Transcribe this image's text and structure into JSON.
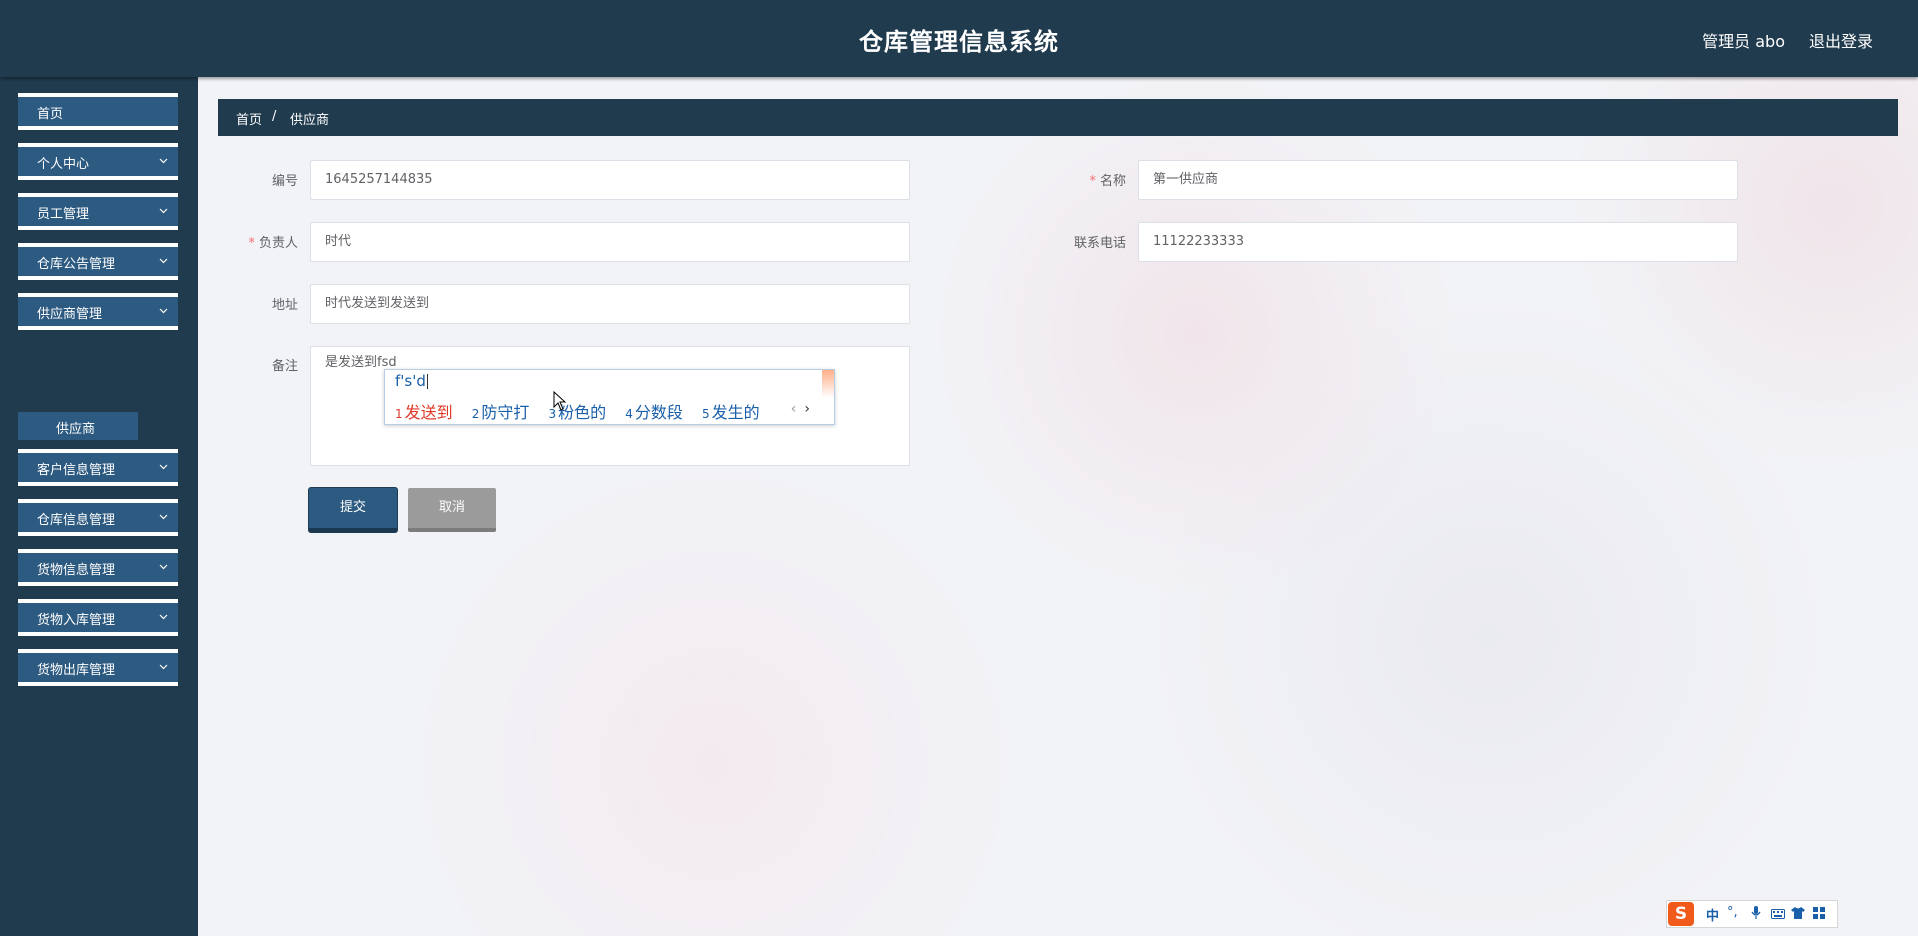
{
  "header": {
    "title": "仓库管理信息系统",
    "user": "管理员 abo",
    "logout": "退出登录"
  },
  "sidebar": {
    "items": [
      {
        "label": "首页"
      },
      {
        "label": "个人中心"
      },
      {
        "label": "员工管理"
      },
      {
        "label": "仓库公告管理"
      },
      {
        "label": "供应商管理"
      },
      {
        "label": "客户信息管理"
      },
      {
        "label": "仓库信息管理"
      },
      {
        "label": "货物信息管理"
      },
      {
        "label": "货物入库管理"
      },
      {
        "label": "货物出库管理"
      }
    ],
    "sub_item": "供应商",
    "chevron_icon": "chevron-down-icon"
  },
  "breadcrumb": {
    "home": "首页",
    "separator": "/",
    "current": "供应商"
  },
  "form": {
    "code": {
      "label": "编号",
      "value": "1645257144835"
    },
    "name": {
      "label": "名称",
      "value": "第一供应商",
      "required_mark": "*"
    },
    "manager": {
      "label": "负责人",
      "value": "时代",
      "required_mark": "*"
    },
    "phone": {
      "label": "联系电话",
      "value": "11122233333"
    },
    "address": {
      "label": "地址",
      "value": "时代发送到发送到"
    },
    "remark": {
      "label": "备注",
      "value": "是发送到fsd"
    }
  },
  "buttons": {
    "submit": "提交",
    "cancel": "取消"
  },
  "ime": {
    "composition": "f's'd",
    "candidates": [
      {
        "num": "1",
        "text": "发送到"
      },
      {
        "num": "2",
        "text": "防守打"
      },
      {
        "num": "3",
        "text": "粉色的"
      },
      {
        "num": "4",
        "text": "分数段"
      },
      {
        "num": "5",
        "text": "发生的"
      }
    ],
    "prev": "‹",
    "next": "›",
    "status_logo": "S",
    "status_mode": "中",
    "status_punct": "°,"
  },
  "colors": {
    "nav_bg": "#203a4e",
    "menu_bg": "#2d5a80",
    "required": "#f56c6c",
    "cancel_bg": "#9b9b9b"
  }
}
